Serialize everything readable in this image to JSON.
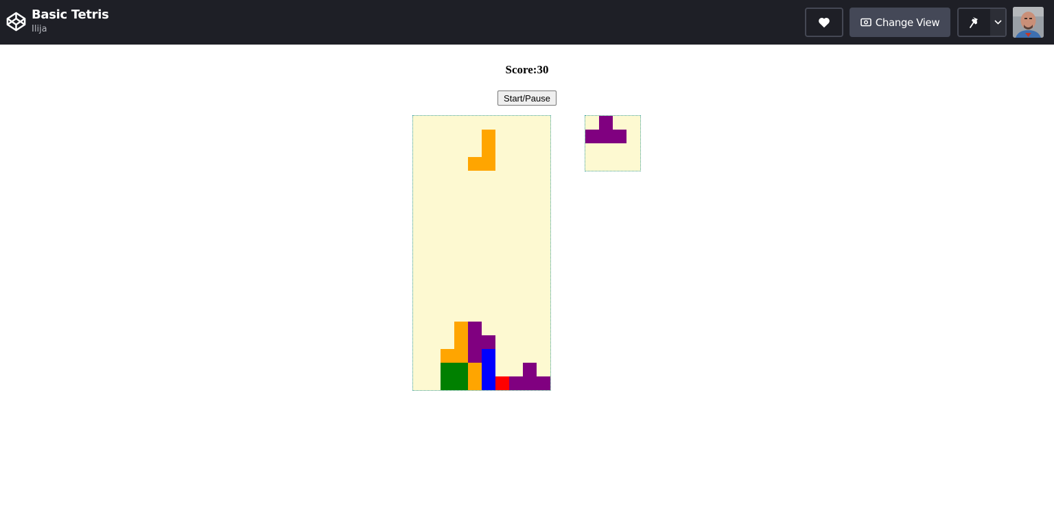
{
  "header": {
    "title": "Basic Tetris",
    "author": "Ilija",
    "change_view_label": "Change View",
    "icons": {
      "logo": "codepen-logo-icon",
      "heart": "heart-icon",
      "change_view": "eye-icon",
      "pin": "pin-icon",
      "caret": "chevron-down-icon",
      "avatar": "user-avatar"
    }
  },
  "game": {
    "score_text": "Score:30",
    "score_label": "Score",
    "score": 30,
    "start_pause_label": "Start/Pause",
    "colors": {
      "background": "#fdf9d1",
      "border": "#3aa0a0",
      "O": "green",
      "L": "orange",
      "T": "purple",
      "I": "blue",
      "Z": "red"
    },
    "board": {
      "columns": 10,
      "rows": 20,
      "cells": [
        {
          "row": 1,
          "col": 5,
          "color": "orange"
        },
        {
          "row": 2,
          "col": 5,
          "color": "orange"
        },
        {
          "row": 3,
          "col": 4,
          "color": "orange"
        },
        {
          "row": 3,
          "col": 5,
          "color": "orange"
        },
        {
          "row": 15,
          "col": 3,
          "color": "orange"
        },
        {
          "row": 15,
          "col": 4,
          "color": "purple"
        },
        {
          "row": 16,
          "col": 3,
          "color": "orange"
        },
        {
          "row": 16,
          "col": 4,
          "color": "purple"
        },
        {
          "row": 16,
          "col": 5,
          "color": "purple"
        },
        {
          "row": 17,
          "col": 2,
          "color": "orange"
        },
        {
          "row": 17,
          "col": 3,
          "color": "orange"
        },
        {
          "row": 17,
          "col": 4,
          "color": "purple"
        },
        {
          "row": 17,
          "col": 5,
          "color": "blue"
        },
        {
          "row": 18,
          "col": 2,
          "color": "green"
        },
        {
          "row": 18,
          "col": 3,
          "color": "green"
        },
        {
          "row": 18,
          "col": 4,
          "color": "orange"
        },
        {
          "row": 18,
          "col": 5,
          "color": "blue"
        },
        {
          "row": 18,
          "col": 8,
          "color": "purple"
        },
        {
          "row": 19,
          "col": 2,
          "color": "green"
        },
        {
          "row": 19,
          "col": 3,
          "color": "green"
        },
        {
          "row": 19,
          "col": 4,
          "color": "orange"
        },
        {
          "row": 19,
          "col": 5,
          "color": "blue"
        },
        {
          "row": 19,
          "col": 6,
          "color": "red"
        },
        {
          "row": 19,
          "col": 7,
          "color": "purple"
        },
        {
          "row": 19,
          "col": 8,
          "color": "purple"
        },
        {
          "row": 19,
          "col": 9,
          "color": "purple"
        }
      ]
    },
    "next_piece": {
      "columns": 4,
      "rows": 4,
      "cells": [
        {
          "row": 0,
          "col": 1,
          "color": "purple"
        },
        {
          "row": 1,
          "col": 0,
          "color": "purple"
        },
        {
          "row": 1,
          "col": 1,
          "color": "purple"
        },
        {
          "row": 1,
          "col": 2,
          "color": "purple"
        }
      ]
    }
  }
}
